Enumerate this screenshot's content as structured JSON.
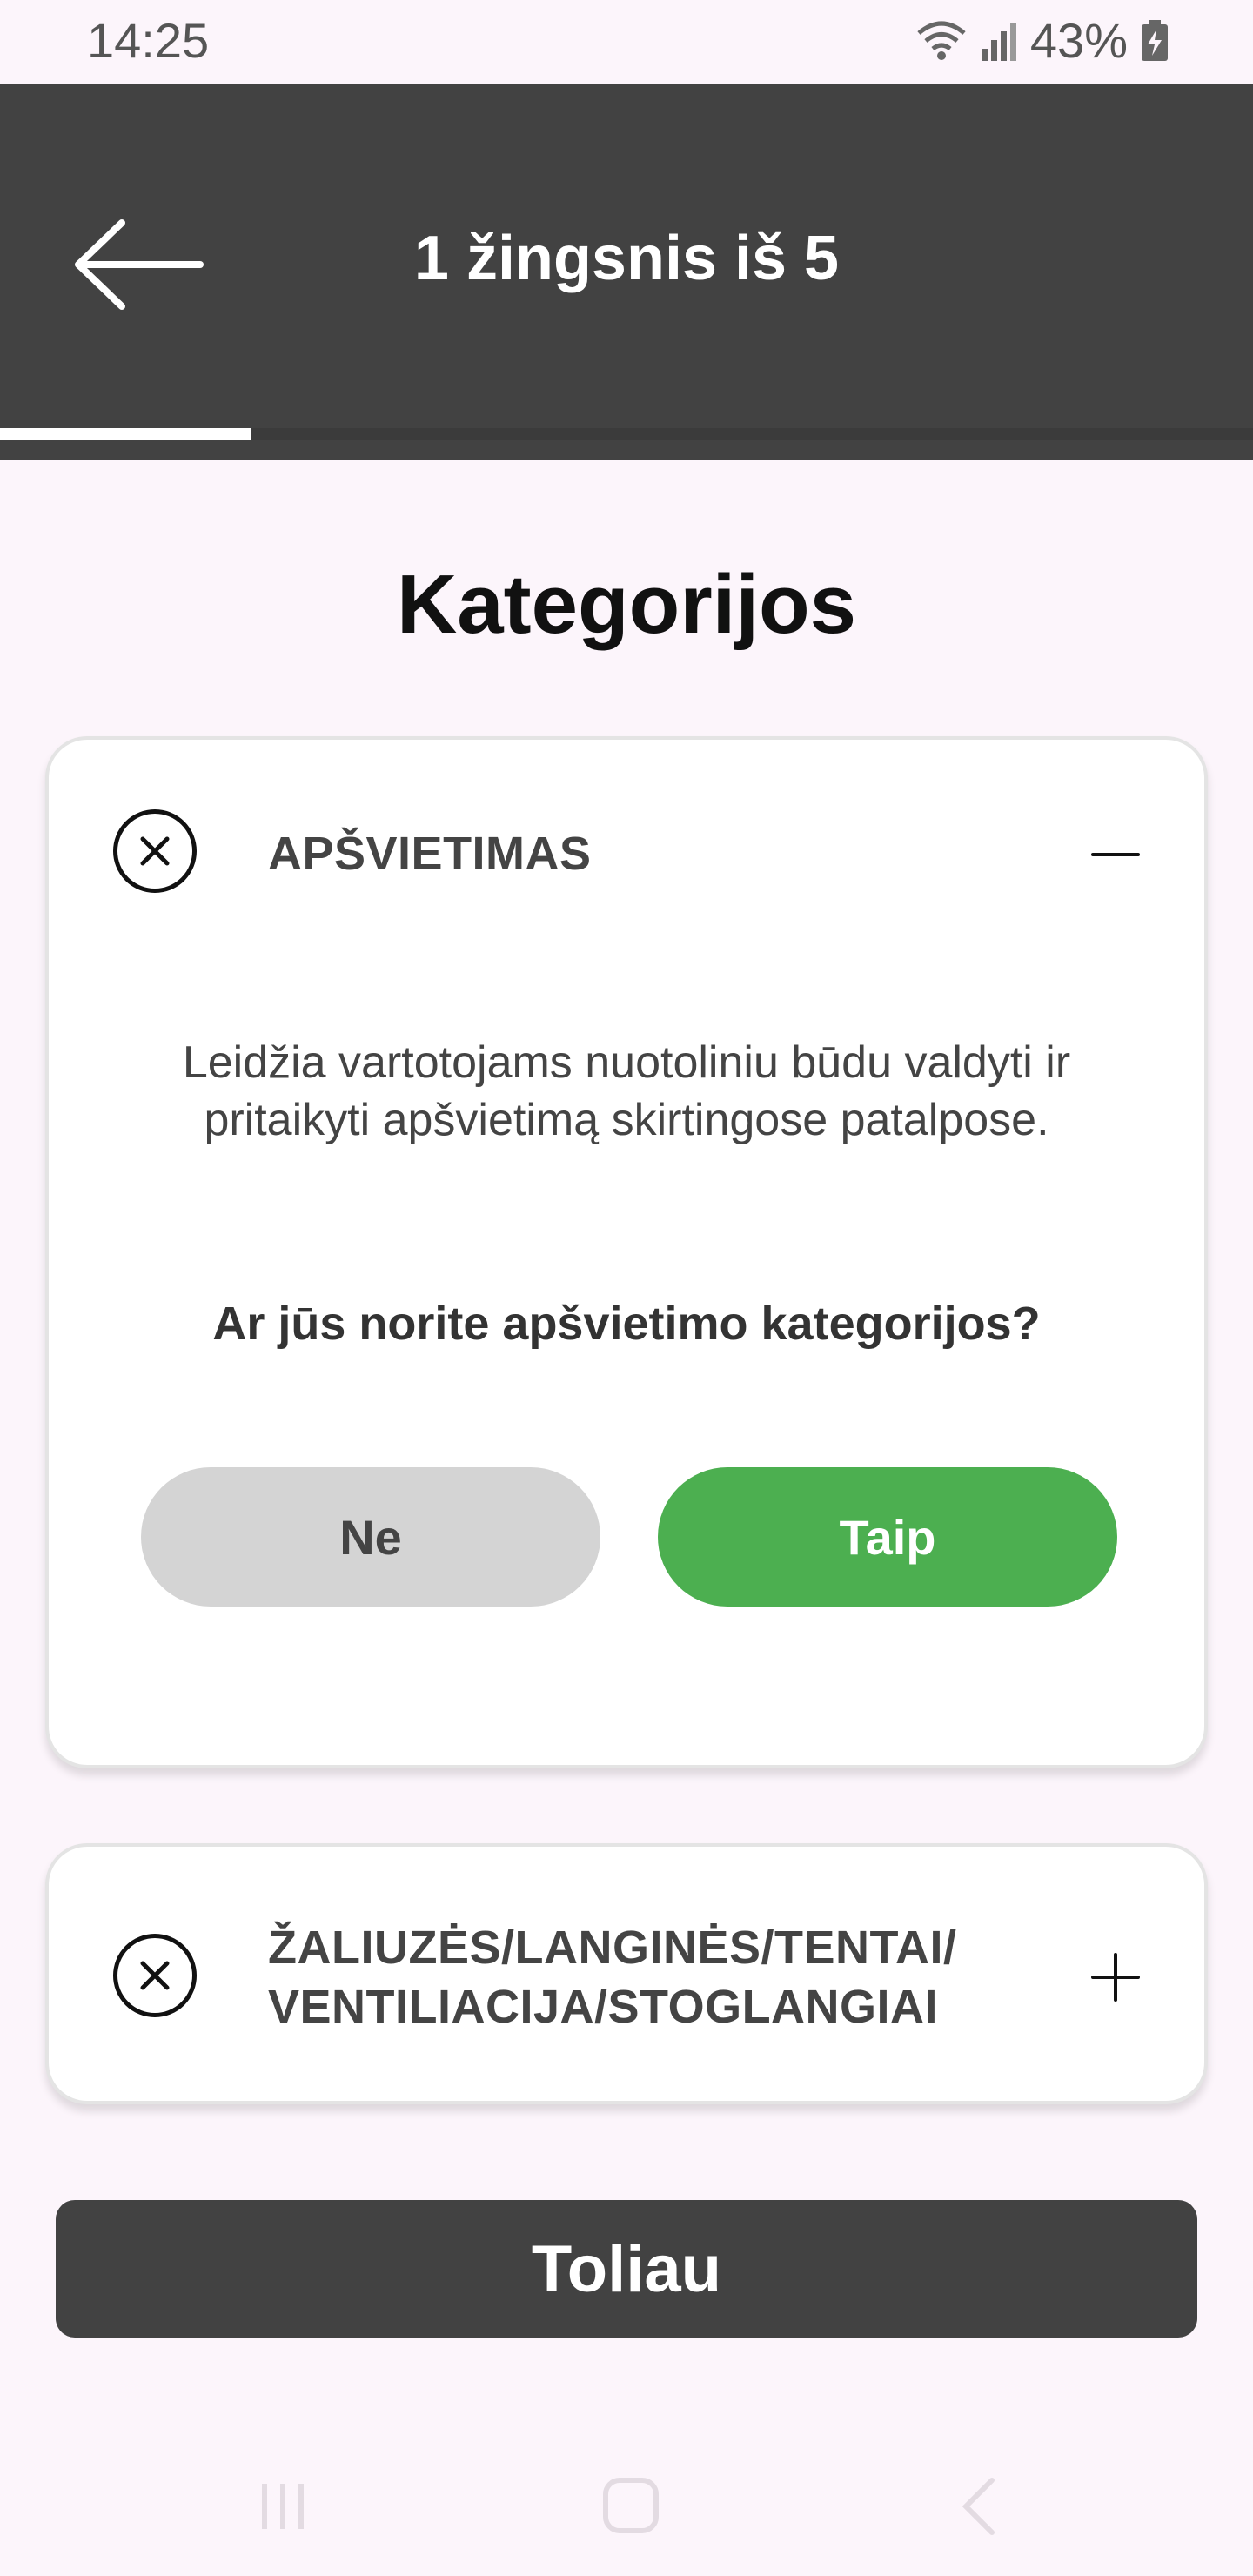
{
  "status_bar": {
    "time": "14:25",
    "battery_percent": "43%",
    "icons": [
      "wifi-icon",
      "signal-icon",
      "battery-charging-icon"
    ]
  },
  "header": {
    "back_icon": "arrow-left-icon",
    "title": "1 žingsnis iš 5",
    "progress_fraction": 0.2
  },
  "main": {
    "title": "Kategorijos",
    "categories": [
      {
        "label": "APŠVIETIMAS",
        "expanded": true,
        "toggle_icon": "minus-icon",
        "remove_icon": "close-circle-icon",
        "description": "Leidžia vartotojams nuotoliniu būdu valdyti ir pritaikyti apšvietimą skirtingose patalpose.",
        "question": "Ar jūs norite apšvietimo kategorijos?",
        "no_label": "Ne",
        "yes_label": "Taip"
      },
      {
        "label": "ŽALIUZĖS/LANGINĖS/TENTAI/ VENTILIACIJA/STOGLANGIAI",
        "expanded": false,
        "toggle_icon": "plus-icon",
        "remove_icon": "close-circle-icon"
      }
    ],
    "next_label": "Toliau"
  },
  "colors": {
    "header_bg": "#424242",
    "page_bg": "#fcf5fb",
    "yes_green": "#4caf50",
    "no_gray": "#d4d4d4"
  },
  "nav_bar": {
    "icons": [
      "recent-apps-icon",
      "home-icon",
      "back-nav-icon"
    ]
  }
}
